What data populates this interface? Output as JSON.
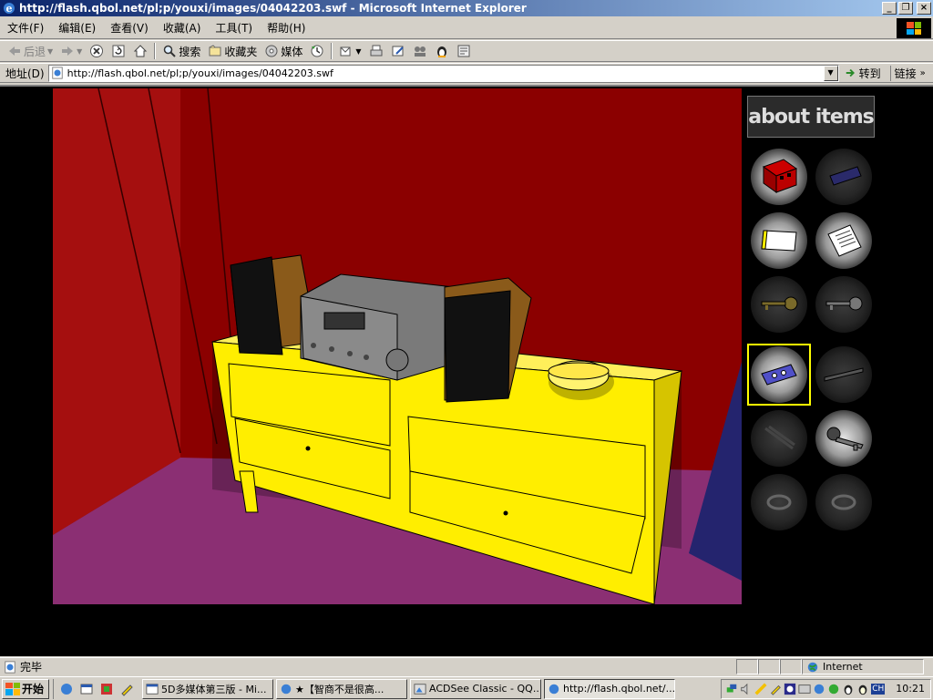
{
  "window": {
    "title": "http://flash.qbol.net/pl;p/youxi/images/04042203.swf - Microsoft Internet Explorer",
    "minimize": "_",
    "restore": "❐",
    "close": "×"
  },
  "menu": [
    "文件(F)",
    "编辑(E)",
    "查看(V)",
    "收藏(A)",
    "工具(T)",
    "帮助(H)"
  ],
  "toolbar": {
    "back": "后退",
    "search": "搜索",
    "favorites": "收藏夹",
    "media": "媒体"
  },
  "address": {
    "label": "地址(D)",
    "url": "http://flash.qbol.net/pl;p/youxi/images/04042203.swf",
    "go": "转到",
    "links": "链接",
    "links_more": "»"
  },
  "game": {
    "about_items": "about items",
    "selected_slot": 6
  },
  "colors": {
    "wall": "#8b0000",
    "floor": "#8b2f73",
    "dresser": "#ffee00",
    "selection": "#ffff00"
  },
  "status": {
    "text": "完毕",
    "zone": "Internet"
  },
  "taskbar": {
    "start": "开始",
    "tasks": [
      "5D多媒体第三版 - Mi...",
      "★【智商不是很高...",
      "ACDSee Classic - QQ...",
      "http://flash.qbol.net/..."
    ],
    "lang": "CH",
    "clock": "10:21"
  }
}
